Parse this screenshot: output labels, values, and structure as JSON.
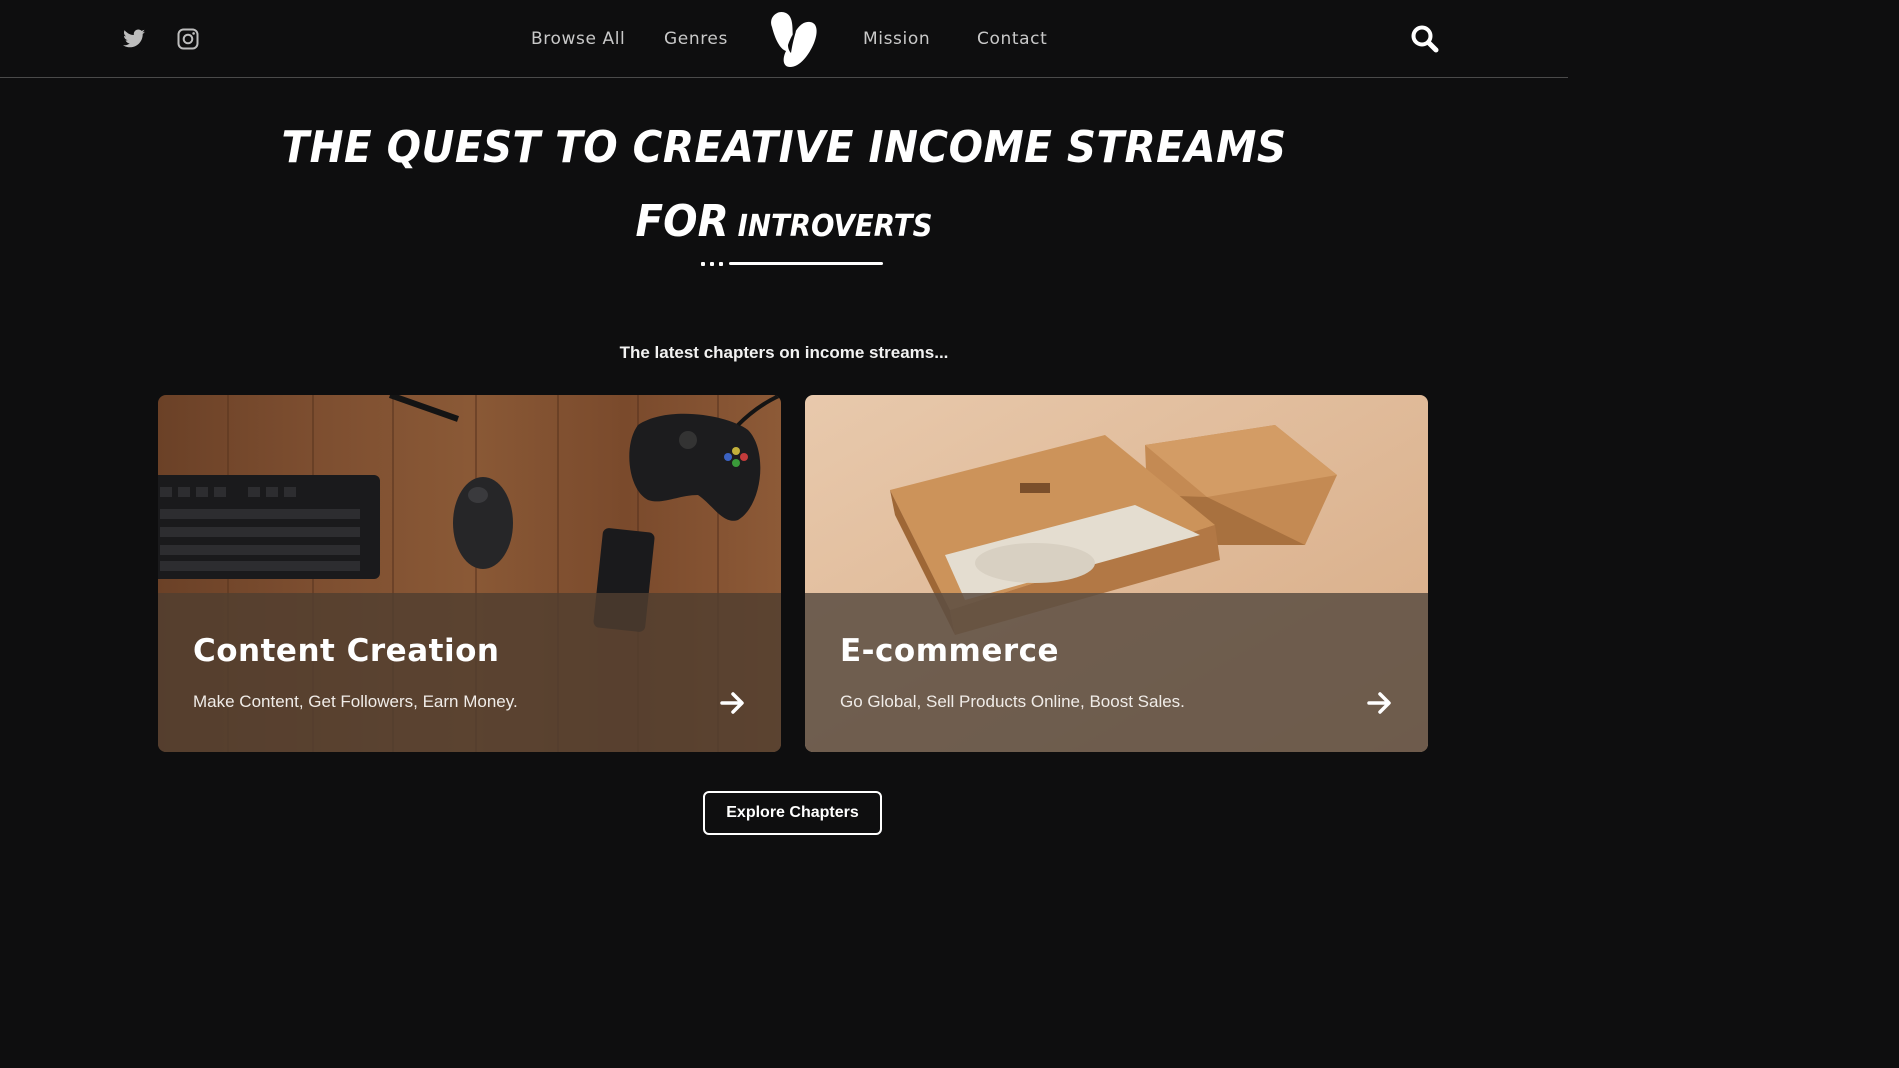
{
  "header": {
    "nav": {
      "browse_all": "Browse All",
      "genres": "Genres",
      "mission": "Mission",
      "contact": "Contact"
    },
    "social_icons": [
      "twitter-icon",
      "instagram-icon"
    ],
    "logo_icon": "brand-logo",
    "search_icon": "search-icon"
  },
  "hero": {
    "title_line1": "THE QUEST TO CREATIVE INCOME STREAMS",
    "title_for": "FOR",
    "title_introverts": "INTROVERTS"
  },
  "latest_label": "The latest chapters on income streams...",
  "cards": [
    {
      "title": "Content Creation",
      "description": "Make Content, Get Followers, Earn Money.",
      "image": "desk-with-keyboard-mouse-controller-phone",
      "arrow_icon": "arrow-right-icon"
    },
    {
      "title": "E-commerce",
      "description": "Go Global, Sell Products Online, Boost Sales.",
      "image": "cardboard-product-box",
      "arrow_icon": "arrow-right-icon"
    }
  ],
  "explore_button": "Explore Chapters",
  "colors": {
    "background": "#0e0e0f",
    "text": "#ffffff",
    "nav_text": "#c9c9c9",
    "card_overlay": "#503e30"
  }
}
